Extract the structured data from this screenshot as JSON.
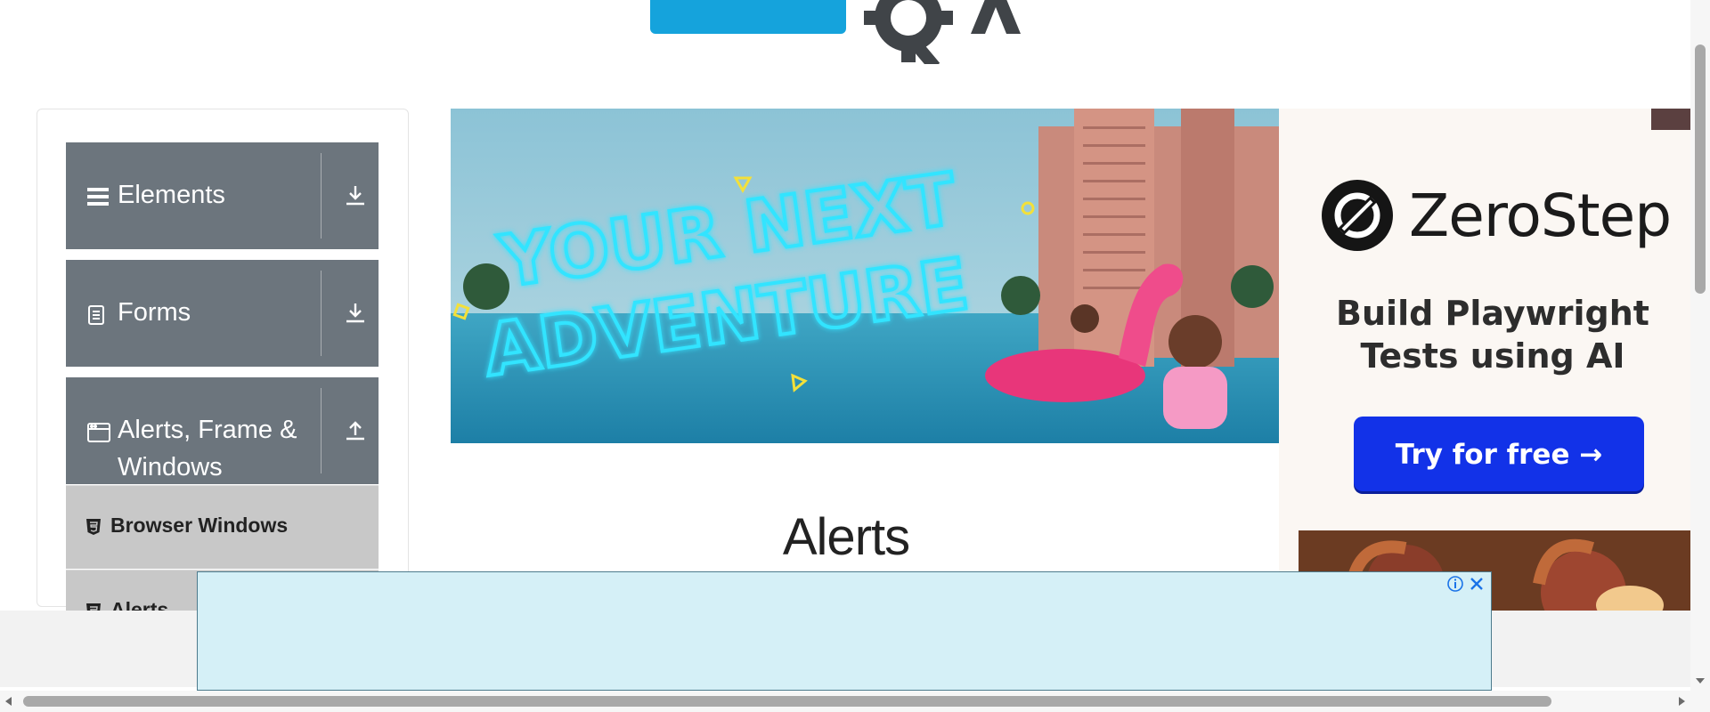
{
  "sidebar": {
    "groups": [
      {
        "label": "Elements",
        "icon": "hamburger-icon",
        "toggle": "download-icon"
      },
      {
        "label": "Forms",
        "icon": "document-icon",
        "toggle": "download-icon"
      },
      {
        "label": "Alerts, Frame &",
        "label_line2": "Windows",
        "icon": "window-icon",
        "toggle": "upload-icon"
      }
    ],
    "sub_items": [
      {
        "label": "Browser Windows",
        "icon": "html5-icon"
      },
      {
        "label": "Alerts",
        "icon": "html5-icon"
      }
    ]
  },
  "banner": {
    "line1": "YOUR NEXT",
    "line2": "ADVENTURE"
  },
  "main": {
    "title": "Alerts"
  },
  "right_ad": {
    "brand": "ZeroStep",
    "tagline_line1": "Build Playwright",
    "tagline_line2": "Tests using AI",
    "cta": "Try for free →"
  },
  "colors": {
    "sidebar_group_bg": "#6c757d",
    "sidebar_sub_bg": "#c8c8c8",
    "cta_blue": "#1232e8",
    "bottom_ad_bg": "#d5f0f7",
    "logo_blue": "#15a3dc"
  }
}
